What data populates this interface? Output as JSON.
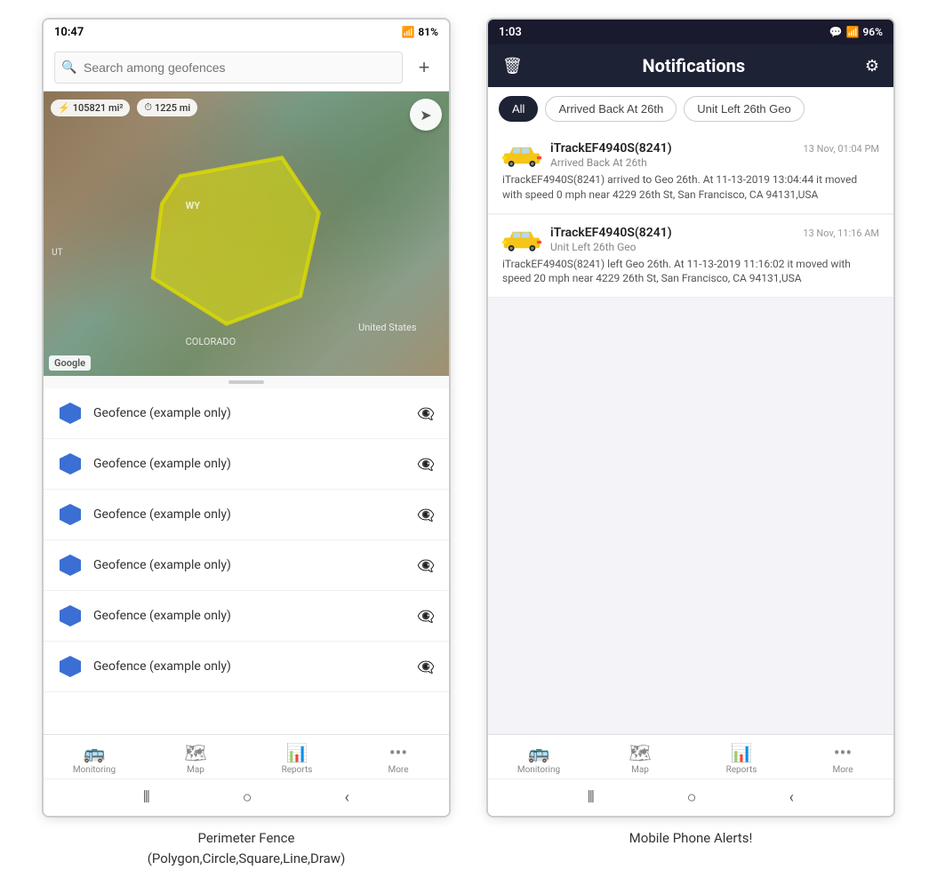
{
  "left_phone": {
    "status_bar": {
      "time": "10:47",
      "wifi": "WiFi",
      "signal": "Signal",
      "battery": "81%"
    },
    "search": {
      "placeholder": "Search among geofences"
    },
    "map": {
      "stat1": "105821 mi²",
      "stat2": "1225 mi",
      "label_wy": "WY",
      "label_us": "United States",
      "label_co": "COLORADO",
      "label_ut": "UT"
    },
    "geofence_items": [
      "Geofence (example only)",
      "Geofence (example only)",
      "Geofence (example only)",
      "Geofence (example only)",
      "Geofence (example only)",
      "Geofence (example only)"
    ],
    "nav": {
      "items": [
        {
          "label": "Monitoring",
          "icon": "🚌"
        },
        {
          "label": "Map",
          "icon": "🗺"
        },
        {
          "label": "Reports",
          "icon": "📊"
        },
        {
          "label": "More",
          "icon": "···"
        }
      ]
    },
    "caption": "Perimeter Fence\n(Polygon,Circle,Square,Line,Draw)"
  },
  "right_phone": {
    "status_bar": {
      "time": "1:03",
      "battery": "96%"
    },
    "header": {
      "title": "Notifications",
      "delete_icon": "🗑",
      "settings_icon": "⚙"
    },
    "filters": [
      {
        "label": "All",
        "active": true
      },
      {
        "label": "Arrived Back At 26th",
        "active": false
      },
      {
        "label": "Unit Left 26th Geo",
        "active": false
      }
    ],
    "notifications": [
      {
        "device": "iTrackEF4940S(8241)",
        "timestamp": "13 Nov, 01:04 PM",
        "event_type": "Arrived Back At 26th",
        "description": "iTrackEF4940S(8241) arrived to Geo 26th.   At 11-13-2019 13:04:44 it moved with speed 0 mph near 4229 26th St, San Francisco, CA 94131,USA"
      },
      {
        "device": "iTrackEF4940S(8241)",
        "timestamp": "13 Nov, 11:16 AM",
        "event_type": "Unit Left 26th Geo",
        "description": "iTrackEF4940S(8241) left Geo 26th.   At 11-13-2019 11:16:02 it moved with speed 20 mph near 4229 26th St, San Francisco, CA 94131,USA"
      }
    ],
    "nav": {
      "items": [
        {
          "label": "Monitoring",
          "icon": "🚌"
        },
        {
          "label": "Map",
          "icon": "🗺"
        },
        {
          "label": "Reports",
          "icon": "📊"
        },
        {
          "label": "More",
          "icon": "···"
        }
      ]
    },
    "caption": "Mobile Phone Alerts!"
  }
}
